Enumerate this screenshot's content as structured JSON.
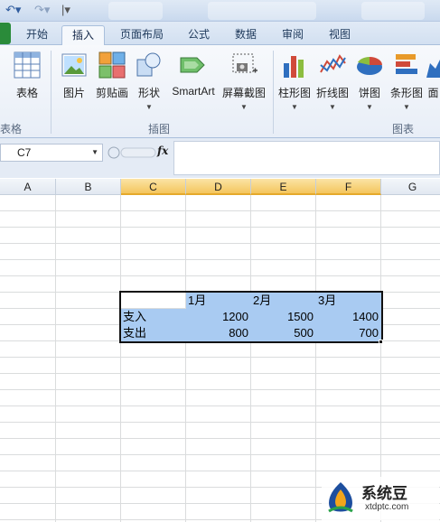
{
  "ribbon_tabs": [
    "开始",
    "插入",
    "页面布局",
    "公式",
    "数据",
    "审阅",
    "视图"
  ],
  "active_tab": "插入",
  "ribbon": {
    "table_btn": "表格",
    "picture_btn": "图片",
    "clipart_btn": "剪贴画",
    "shapes_btn": "形状",
    "smartart_btn": "SmartArt",
    "screenshot_btn": "屏幕截图",
    "column_chart_btn": "柱形图",
    "line_chart_btn": "折线图",
    "pie_chart_btn": "饼图",
    "bar_chart_btn": "条形图",
    "area_chart_btn": "面",
    "group_tables": "表格",
    "group_illustrations": "插图",
    "group_charts": "图表"
  },
  "formula_bar": {
    "name_box": "C7",
    "fx_label": "fx",
    "value": ""
  },
  "sheet": {
    "columns": [
      "A",
      "B",
      "C",
      "D",
      "E",
      "F",
      "G"
    ],
    "selected_columns": [
      "C",
      "D",
      "E",
      "F"
    ],
    "table": {
      "headers": [
        "",
        "1月",
        "2月",
        "3月"
      ],
      "rows": [
        {
          "label": "支入",
          "values": [
            "1200",
            "1500",
            "1400"
          ]
        },
        {
          "label": "支出",
          "values": [
            "800",
            "500",
            "700"
          ]
        }
      ]
    }
  },
  "colors": {
    "selection_fill": "#a9cbf2",
    "selected_header": "#f4c55e",
    "file_tab": "#2a8b3a"
  },
  "watermark": {
    "name": "系统豆",
    "domain": "xtdptc.com"
  }
}
